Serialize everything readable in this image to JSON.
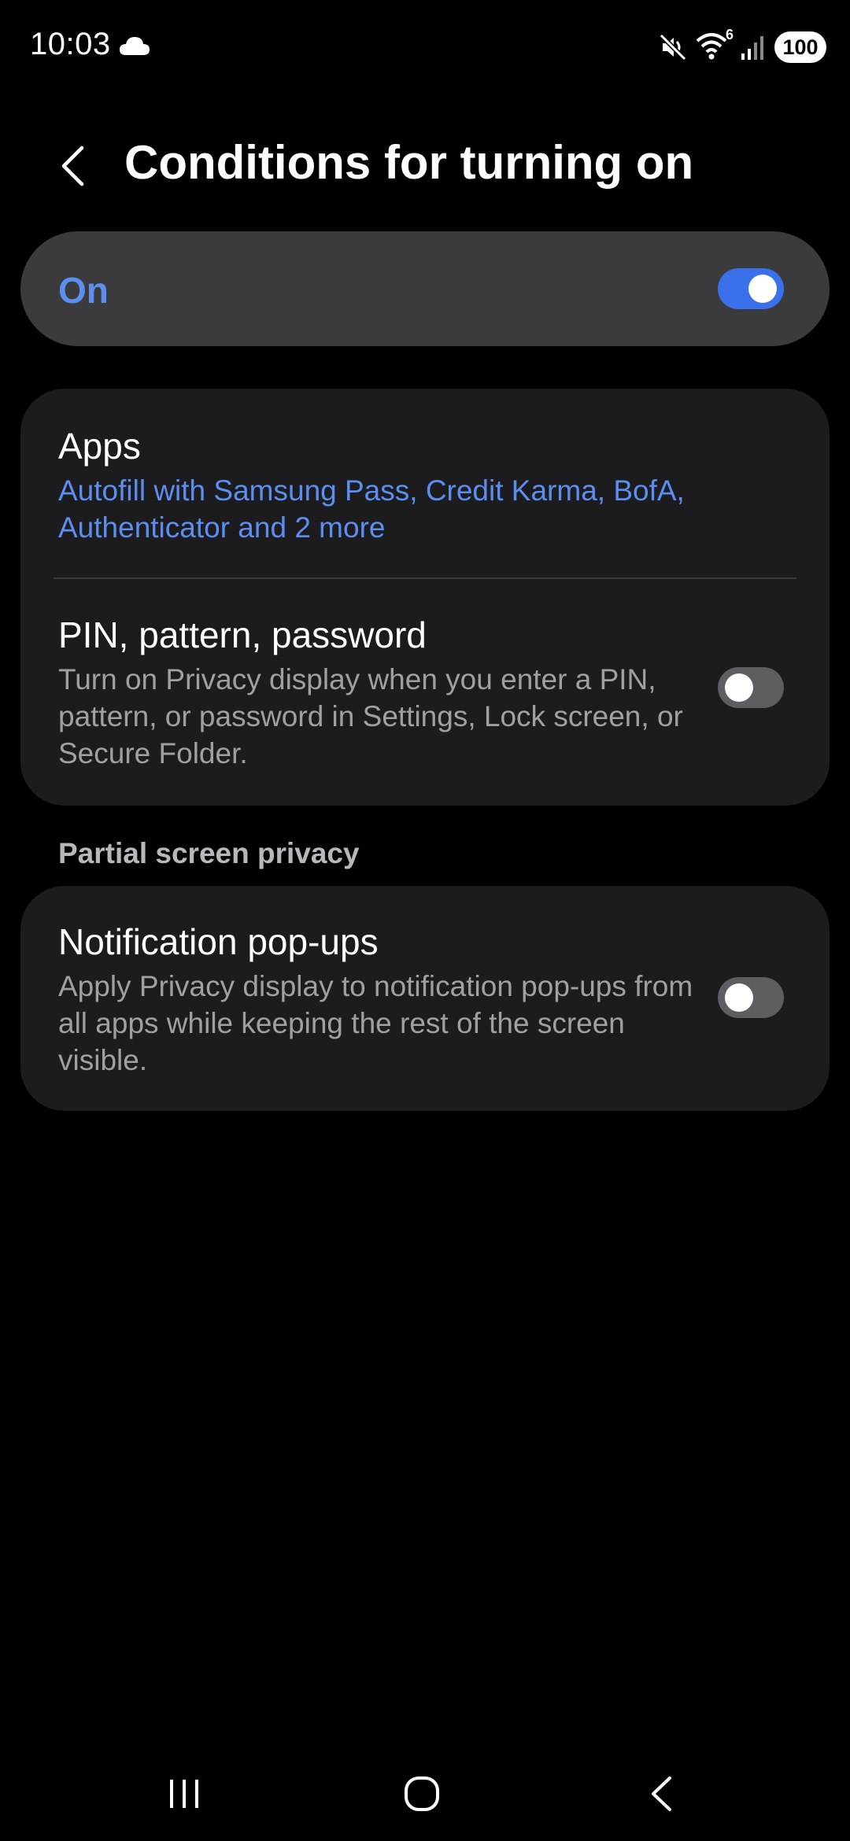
{
  "status_bar": {
    "time": "10:03",
    "left_icons": [
      "cloud-icon"
    ],
    "right_icons": [
      "mute-icon",
      "wifi-icon",
      "signal-icon"
    ],
    "wifi_badge": "6",
    "battery": "100"
  },
  "header": {
    "back_icon": "chevron-left-icon",
    "title": "Conditions for turning on"
  },
  "master_switch": {
    "label": "On",
    "checked": true,
    "accent_color": "#3a71ea"
  },
  "apps_card": {
    "apps_row": {
      "title": "Apps",
      "summary": "Autofill with Samsung Pass, Credit Karma, BofA, Authenticator and 2 more"
    },
    "pin_row": {
      "title": "PIN, pattern, password",
      "description": "Turn on Privacy display when you enter a PIN, pattern, or password in Settings, Lock screen, or Secure Folder.",
      "checked": false
    }
  },
  "partial_section": {
    "header": "Partial screen privacy",
    "notification_row": {
      "title": "Notification pop-ups",
      "description": "Apply Privacy display to notification pop-ups from all apps while keeping the rest of the screen visible.",
      "checked": false
    }
  },
  "nav_bar": {
    "icons": [
      "recents-icon",
      "home-icon",
      "back-icon"
    ]
  },
  "colors": {
    "background": "#000000",
    "card": "#1c1c1e",
    "master_card": "#3b3b3d",
    "link": "#5c8ef0",
    "toggle_off": "#5e5e62"
  }
}
